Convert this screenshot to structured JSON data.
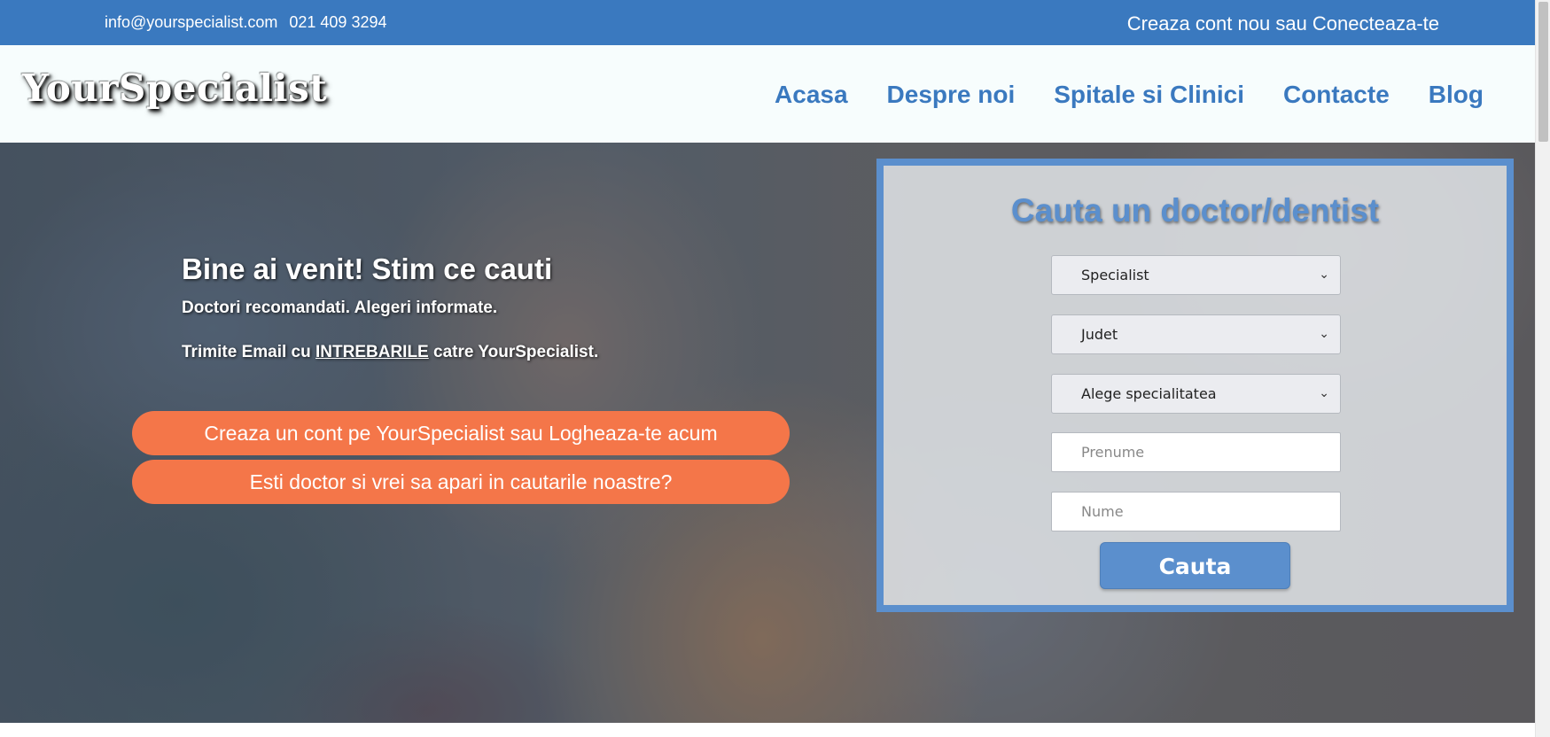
{
  "topbar": {
    "email": "info@yourspecialist.com",
    "phone": "021 409 3294",
    "account_link": "Creaza cont nou sau Conecteaza-te"
  },
  "header": {
    "logo": "YourSpecialist",
    "nav": [
      "Acasa",
      "Despre noi",
      "Spitale si Clinici",
      "Contacte",
      "Blog"
    ]
  },
  "hero": {
    "title": "Bine ai venit! Stim ce cauti",
    "subtitle": "Doctori recomandati. Alegeri informate.",
    "mail_prefix": "Trimite Email cu ",
    "mail_link": "INTREBARILE",
    "mail_suffix": " catre YourSpecialist.",
    "cta_account": "Creaza un cont pe YourSpecialist sau Logheaza-te acum",
    "cta_doctor": "Esti doctor si vrei sa apari in cautarile noastre?"
  },
  "search": {
    "title": "Cauta un doctor/dentist",
    "select_specialist": "Specialist",
    "select_county": "Judet",
    "select_specialty": "Alege specialitatea",
    "first_name_placeholder": "Prenume",
    "last_name_placeholder": "Nume",
    "button": "Cauta"
  },
  "colors": {
    "brand_blue": "#3a79bf",
    "panel_blue": "#5b8fcd",
    "cta_orange": "#f47649"
  }
}
